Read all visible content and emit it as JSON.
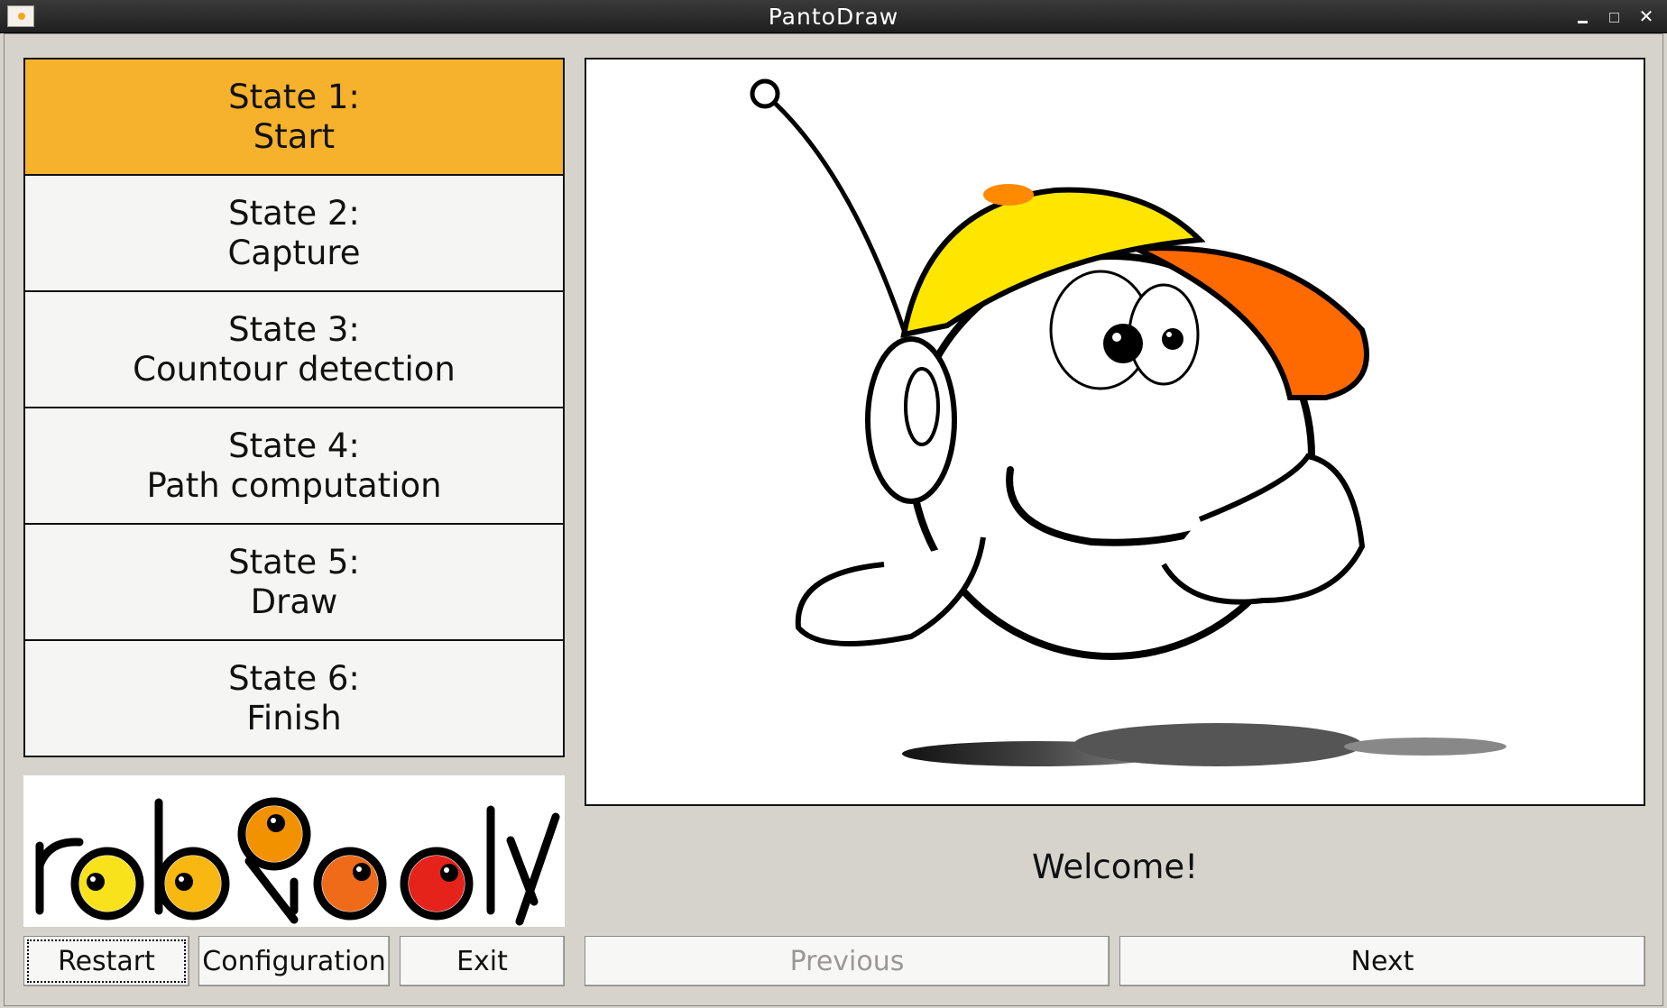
{
  "window": {
    "title": "PantoDraw"
  },
  "states": [
    {
      "title": "State 1:",
      "subtitle": "Start",
      "active": true
    },
    {
      "title": "State 2:",
      "subtitle": "Capture",
      "active": false
    },
    {
      "title": "State 3:",
      "subtitle": "Countour detection",
      "active": false
    },
    {
      "title": "State 4:",
      "subtitle": "Path computation",
      "active": false
    },
    {
      "title": "State 5:",
      "subtitle": "Draw",
      "active": false
    },
    {
      "title": "State 6:",
      "subtitle": "Finish",
      "active": false
    }
  ],
  "logo": {
    "text": "robopoly"
  },
  "status": {
    "message": "Welcome!"
  },
  "buttons": {
    "restart": "Restart",
    "configuration": "Configuration",
    "exit": "Exit",
    "previous": "Previous",
    "next": "Next"
  },
  "colors": {
    "active_state": "#f6b22c",
    "cap_yellow": "#ffe600",
    "cap_orange": "#ff6a00"
  }
}
